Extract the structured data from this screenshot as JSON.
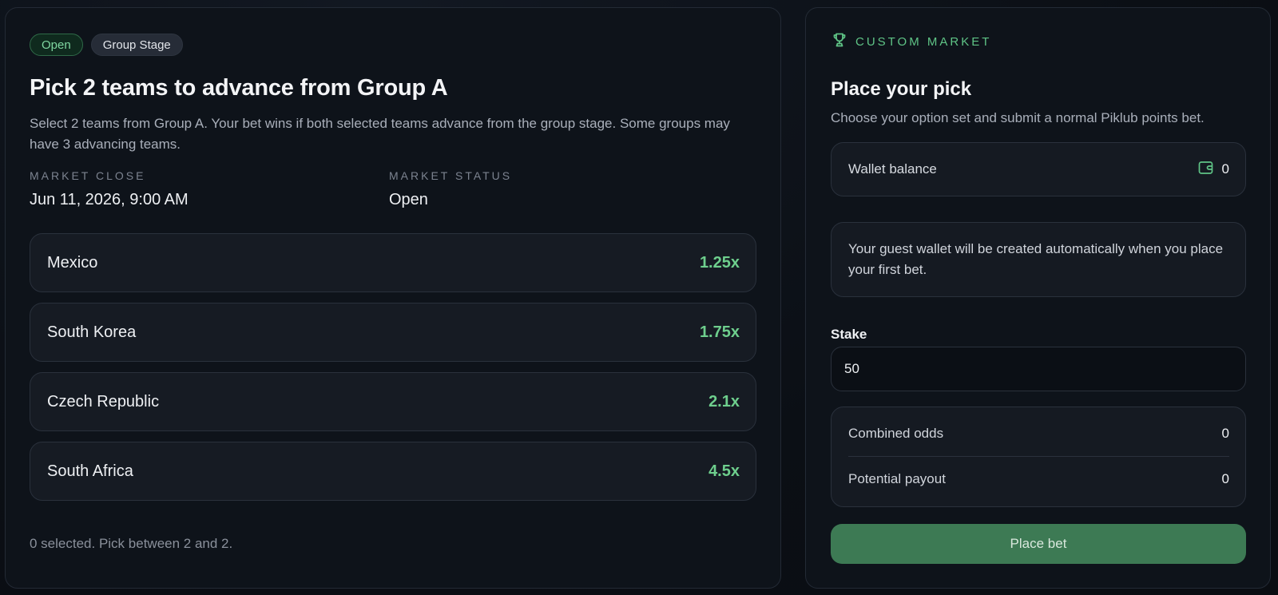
{
  "market": {
    "status_badge": "Open",
    "stage_badge": "Group Stage",
    "title": "Pick 2 teams to advance from Group A",
    "description": "Select 2 teams from Group A. Your bet wins if both selected teams advance from the group stage. Some groups may have 3 advancing teams.",
    "close_label": "MARKET CLOSE",
    "close_value": "Jun 11, 2026, 9:00 AM",
    "status_label": "MARKET STATUS",
    "status_value": "Open",
    "options": [
      {
        "name": "Mexico",
        "odds": "1.25x"
      },
      {
        "name": "South Korea",
        "odds": "1.75x"
      },
      {
        "name": "Czech Republic",
        "odds": "2.1x"
      },
      {
        "name": "South Africa",
        "odds": "4.5x"
      }
    ],
    "selection_info": "0 selected. Pick between 2 and 2."
  },
  "betslip": {
    "header_icon": "trophy-icon",
    "header_label": "CUSTOM MARKET",
    "title": "Place your pick",
    "subtitle": "Choose your option set and submit a normal Piklub points bet.",
    "wallet_label": "Wallet balance",
    "wallet_icon": "wallet-icon",
    "wallet_value": "0",
    "guest_note": "Your guest wallet will be created automatically when you place your first bet.",
    "stake_label": "Stake",
    "stake_value": "50",
    "combined_odds_label": "Combined odds",
    "combined_odds_value": "0",
    "payout_label": "Potential payout",
    "payout_value": "0",
    "place_bet_label": "Place bet"
  },
  "colors": {
    "accent_green": "#6ecf8d",
    "button_green": "#3d7a54",
    "panel_bg": "#0e131a"
  }
}
